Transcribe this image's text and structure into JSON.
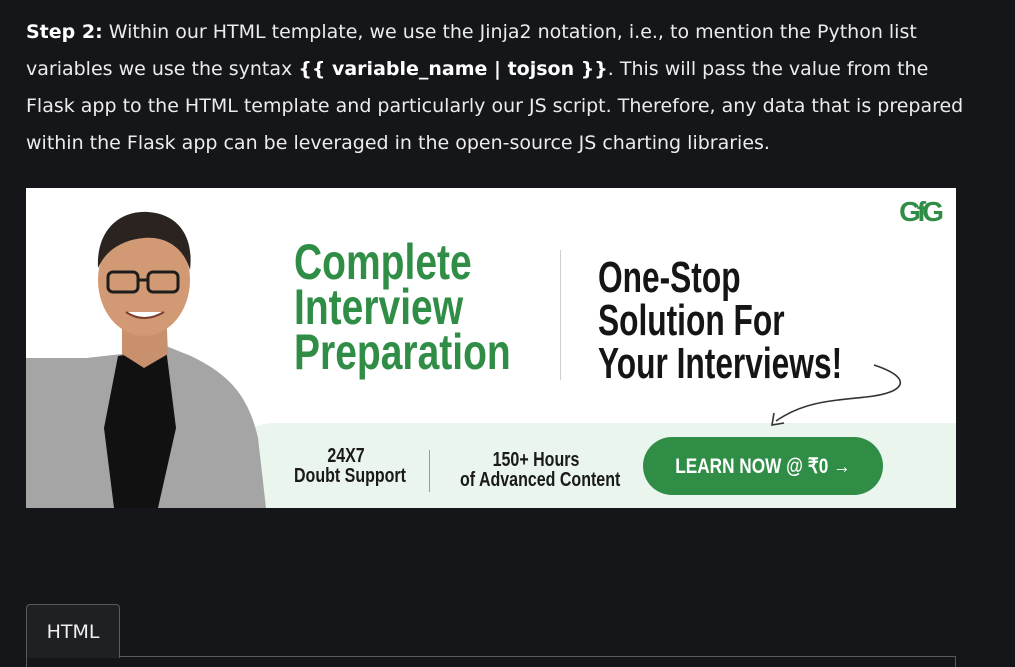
{
  "article": {
    "step_label": "Step 2:",
    "text_1": "  Within our HTML template, we use the Jinja2 notation, i.e., to mention the Python list variables we use the syntax ",
    "syntax": "{{ variable_name | tojson }}",
    "text_2": ". This will pass the value from the Flask app to the HTML template and particularly our JS script. Therefore, any data that is prepared within the Flask app can be leveraged in the open-source JS charting libraries."
  },
  "banner": {
    "logo": "GfG",
    "title_lines": [
      "Complete",
      "Interview",
      "Preparation"
    ],
    "tagline_lines": [
      "One-Stop",
      "Solution For",
      "Your Interviews!"
    ],
    "feature_1": [
      "24X7",
      "Doubt Support"
    ],
    "feature_2": [
      "150+ Hours",
      "of Advanced Content"
    ],
    "cta_label": "LEARN NOW @ ₹0 →",
    "colors": {
      "brand_green": "#2f8d46",
      "band": "#eaf5ee"
    }
  },
  "code_tabs": {
    "active": "HTML"
  }
}
